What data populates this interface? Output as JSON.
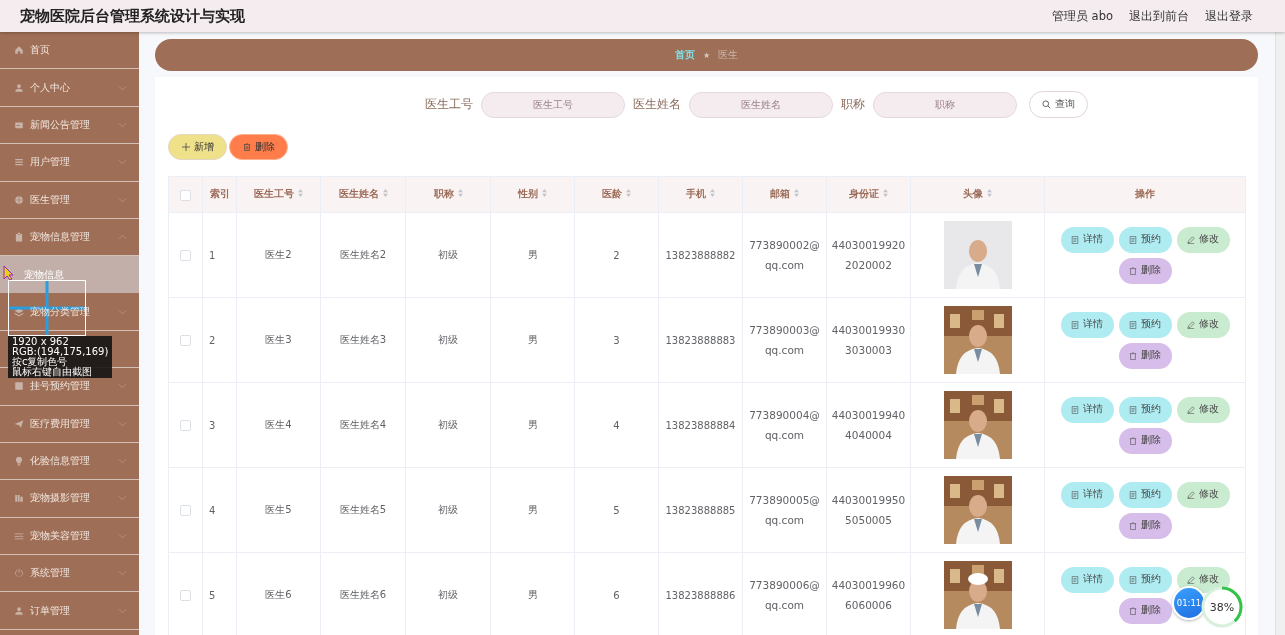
{
  "header": {
    "title": "宠物医院后台管理系统设计与实现",
    "user": "管理员 abo",
    "links": [
      "退出到前台",
      "退出登录"
    ]
  },
  "sidebar": {
    "items": [
      {
        "kind": "menu",
        "label": "首页"
      },
      {
        "kind": "group",
        "label": "个人中心",
        "expanded": false
      },
      {
        "kind": "group",
        "label": "新闻公告管理",
        "expanded": false
      },
      {
        "kind": "group",
        "label": "用户管理",
        "expanded": false
      },
      {
        "kind": "group",
        "label": "医生管理",
        "expanded": false
      },
      {
        "kind": "group",
        "label": "宠物信息管理",
        "expanded": true
      },
      {
        "kind": "sub",
        "label": "宠物信息",
        "selected": true
      },
      {
        "kind": "group",
        "label": "宠物分类管理",
        "expanded": false
      },
      {
        "kind": "covered"
      },
      {
        "kind": "group",
        "label": "挂号预约管理",
        "expanded": false
      },
      {
        "kind": "group",
        "label": "医疗费用管理",
        "expanded": false
      },
      {
        "kind": "group",
        "label": "化验信息管理",
        "expanded": false
      },
      {
        "kind": "group",
        "label": "宠物摄影管理",
        "expanded": false
      },
      {
        "kind": "group",
        "label": "宠物美容管理",
        "expanded": false
      },
      {
        "kind": "group",
        "label": "系统管理",
        "expanded": false
      },
      {
        "kind": "group",
        "label": "订单管理",
        "expanded": false
      }
    ]
  },
  "breadcrumb": {
    "separator": "★",
    "items": [
      {
        "kind": "link",
        "label": "首页"
      },
      {
        "kind": "current",
        "label": "医生"
      }
    ]
  },
  "search": {
    "fields": [
      {
        "label": "医生工号",
        "placeholder": "医生工号"
      },
      {
        "label": "医生姓名",
        "placeholder": "医生姓名"
      },
      {
        "label": "职称",
        "placeholder": "职称"
      }
    ],
    "button": "查询"
  },
  "toolbar": [
    {
      "kind": "add",
      "label": "新增"
    },
    {
      "kind": "delete",
      "label": "删除"
    }
  ],
  "table": {
    "select_all_checked": false,
    "columns": [
      {
        "label": "索引",
        "sortable": false
      },
      {
        "label": "医生工号",
        "sortable": true
      },
      {
        "label": "医生姓名",
        "sortable": true
      },
      {
        "label": "职称",
        "sortable": true
      },
      {
        "label": "性别",
        "sortable": true
      },
      {
        "label": "医龄",
        "sortable": true
      },
      {
        "label": "手机",
        "sortable": true
      },
      {
        "label": "邮箱",
        "sortable": true
      },
      {
        "label": "身份证",
        "sortable": true
      },
      {
        "label": "头像",
        "sortable": true
      },
      {
        "label": "操作",
        "sortable": false
      }
    ],
    "rows": [
      {
        "checked": false,
        "cells": [
          "1",
          "医生2",
          "医生姓名2",
          "初级",
          "男",
          "2",
          "13823888882",
          "773890002@qq.com",
          "440300199202020002"
        ],
        "photo": {
          "kind": "picture"
        },
        "actions": [
          {
            "kind": "detail",
            "label": "详情"
          },
          {
            "kind": "book",
            "label": "预约"
          },
          {
            "kind": "edit",
            "label": "修改"
          },
          {
            "kind": "delete",
            "label": "删除"
          }
        ]
      },
      {
        "checked": false,
        "cells": [
          "2",
          "医生3",
          "医生姓名3",
          "初级",
          "男",
          "3",
          "13823888883",
          "773890003@qq.com",
          "440300199303030003"
        ],
        "photo": {
          "kind": "picture"
        },
        "actions": [
          {
            "kind": "detail",
            "label": "详情"
          },
          {
            "kind": "book",
            "label": "预约"
          },
          {
            "kind": "edit",
            "label": "修改"
          },
          {
            "kind": "delete",
            "label": "删除"
          }
        ]
      },
      {
        "checked": false,
        "cells": [
          "3",
          "医生4",
          "医生姓名4",
          "初级",
          "男",
          "4",
          "13823888884",
          "773890004@qq.com",
          "440300199404040004"
        ],
        "photo": {
          "kind": "picture"
        },
        "actions": [
          {
            "kind": "detail",
            "label": "详情"
          },
          {
            "kind": "book",
            "label": "预约"
          },
          {
            "kind": "edit",
            "label": "修改"
          },
          {
            "kind": "delete",
            "label": "删除"
          }
        ]
      },
      {
        "checked": false,
        "cells": [
          "4",
          "医生5",
          "医生姓名5",
          "初级",
          "男",
          "5",
          "13823888885",
          "773890005@qq.com",
          "440300199505050005"
        ],
        "photo": {
          "kind": "picture"
        },
        "actions": [
          {
            "kind": "detail",
            "label": "详情"
          },
          {
            "kind": "book",
            "label": "预约"
          },
          {
            "kind": "edit",
            "label": "修改"
          },
          {
            "kind": "delete",
            "label": "删除"
          }
        ]
      },
      {
        "checked": false,
        "cells": [
          "5",
          "医生6",
          "医生姓名6",
          "初级",
          "男",
          "6",
          "13823888886",
          "773890006@qq.com",
          "440300199606060006"
        ],
        "photo": {
          "kind": "picture"
        },
        "actions": [
          {
            "kind": "detail",
            "label": "详情"
          },
          {
            "kind": "book",
            "label": "预约"
          },
          {
            "kind": "edit",
            "label": "修改"
          },
          {
            "kind": "delete",
            "label": "删除"
          }
        ]
      }
    ]
  },
  "picker_overlay": {
    "lines": [
      "1920 x 962",
      "RGB:(194,175,169)",
      "按c复制色号",
      "鼠标右键自由截图"
    ]
  },
  "timer_badge": "01:11",
  "progress_ring": {
    "label": "38%",
    "level": 0.38
  }
}
